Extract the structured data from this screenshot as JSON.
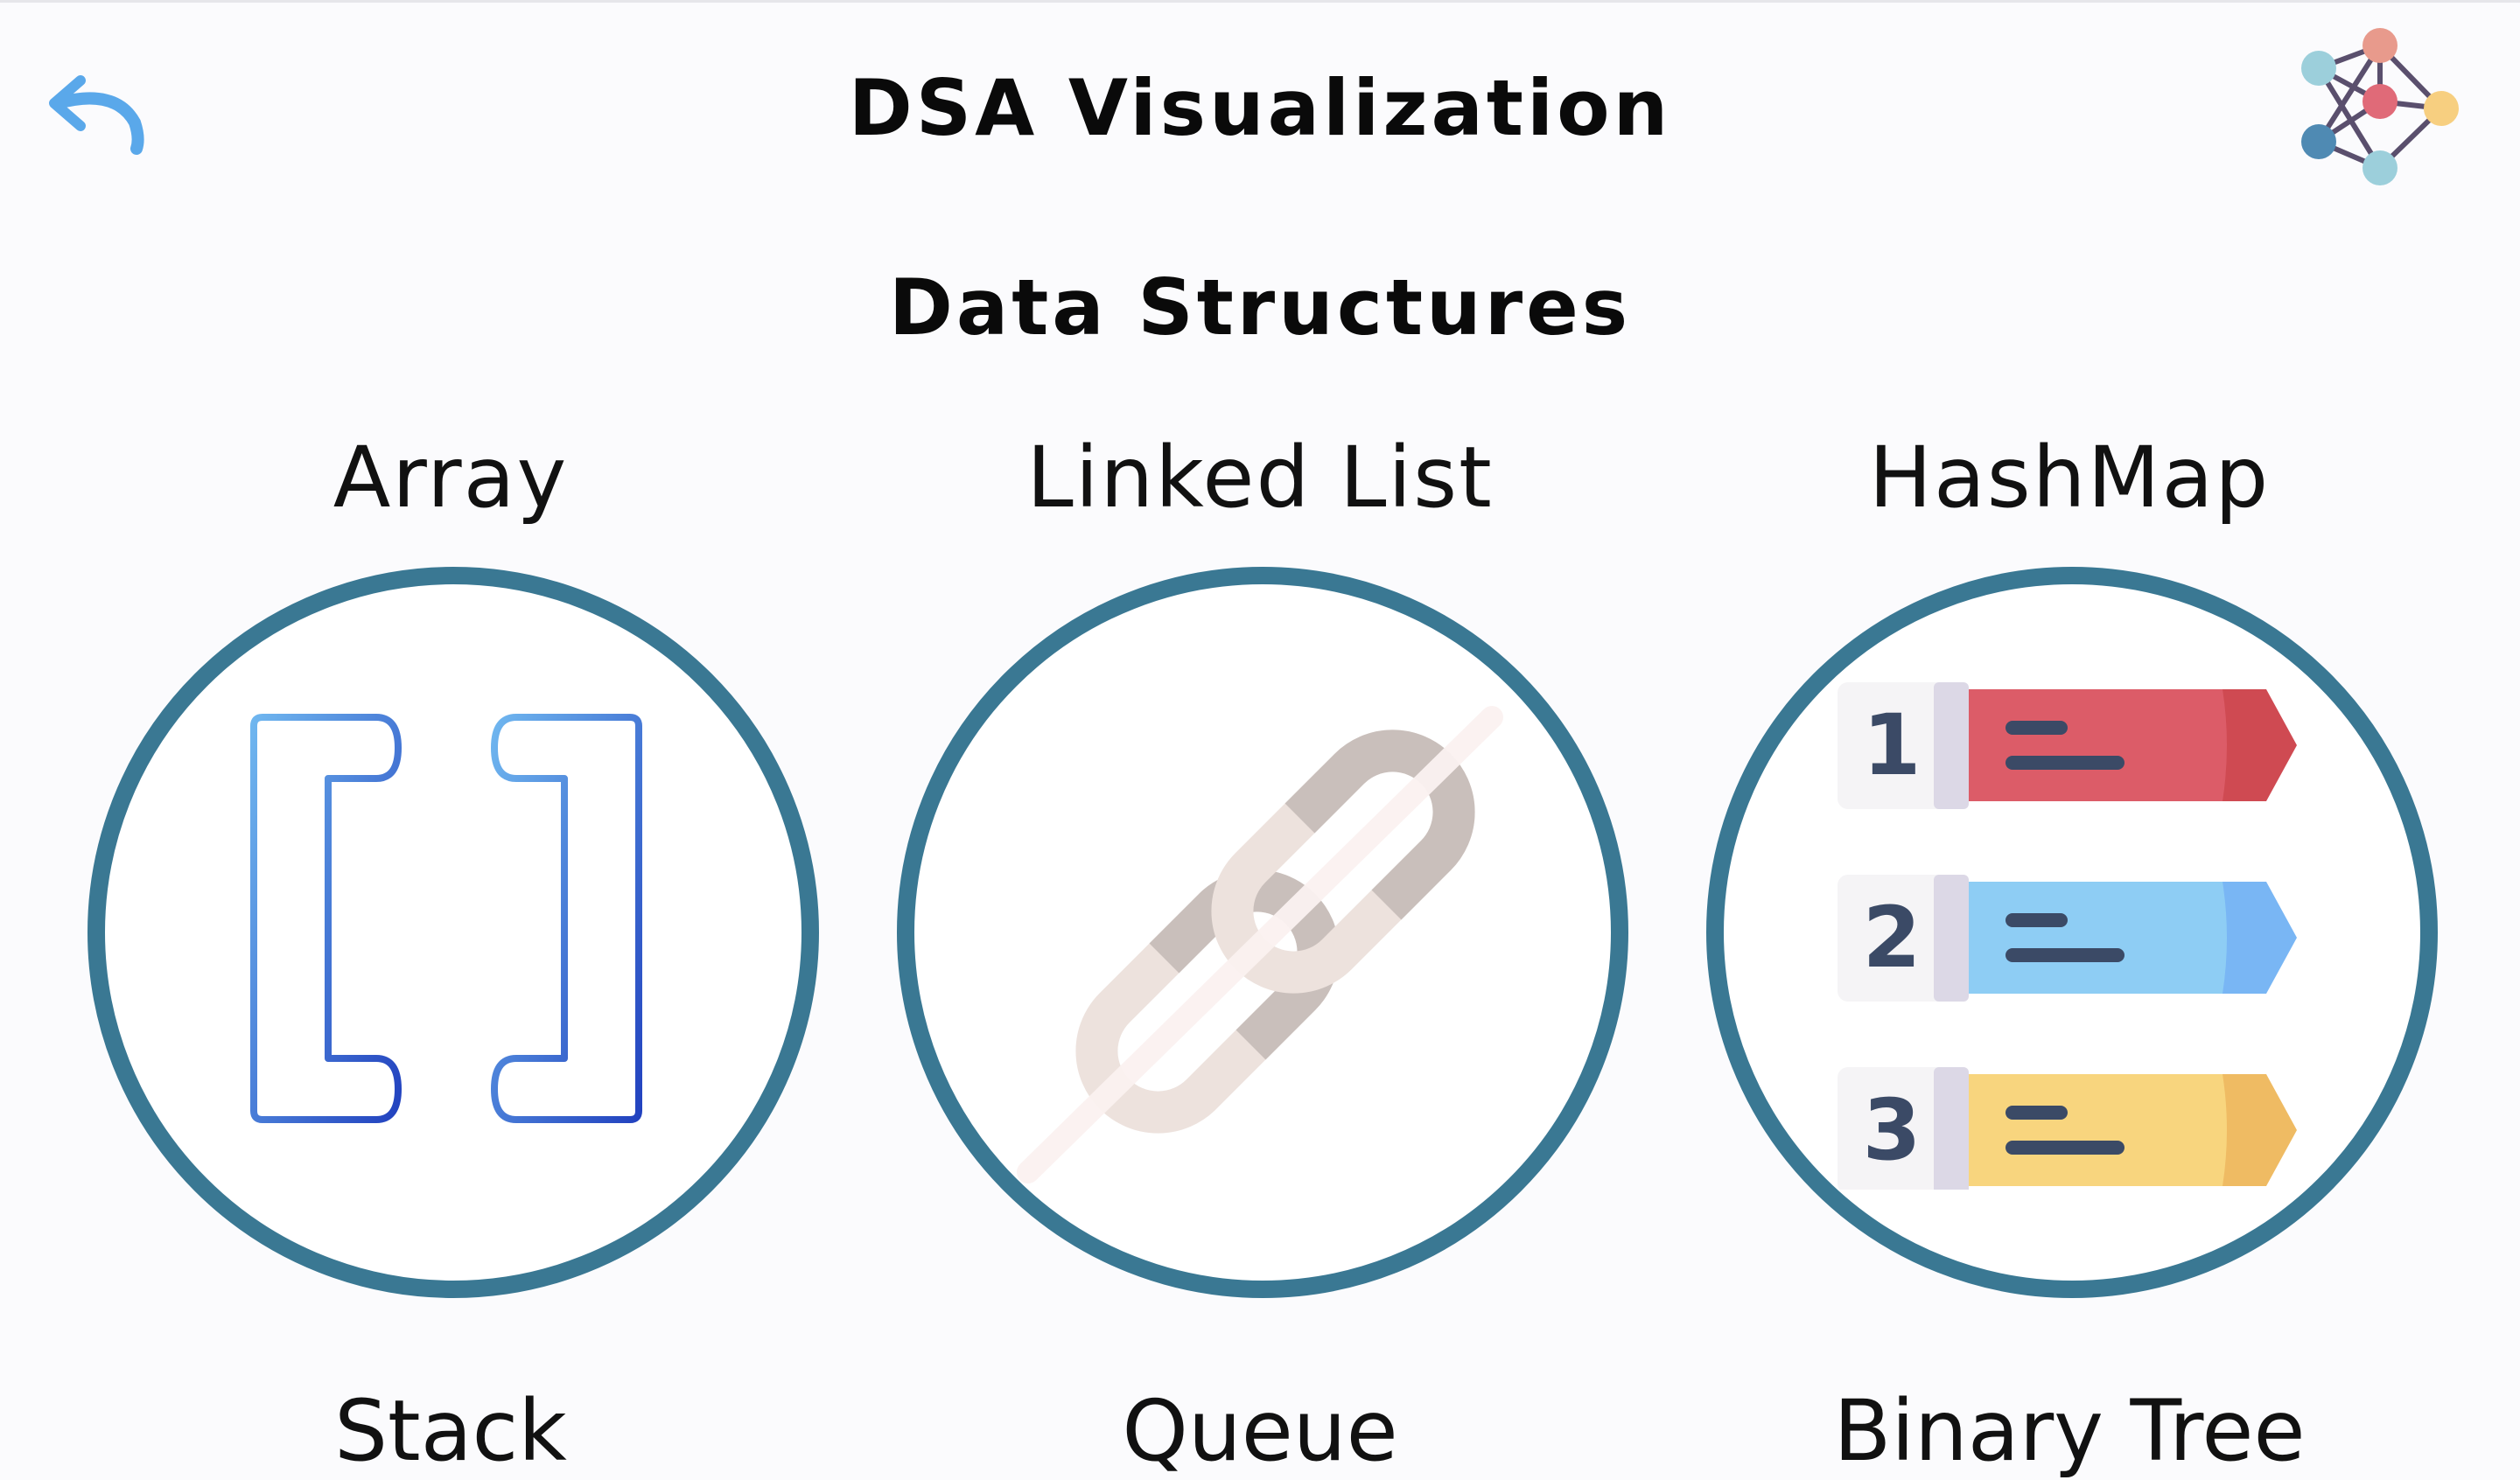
{
  "header": {
    "title": "DSA Visualization",
    "back_icon": "undo-arrow-icon",
    "logo_icon": "network-graph-logo-icon"
  },
  "section": {
    "title": "Data Structures"
  },
  "cards": [
    {
      "label": "Array",
      "icon": "brackets-icon"
    },
    {
      "label": "Linked List",
      "icon": "chain-icon"
    },
    {
      "label": "HashMap",
      "icon": "numbered-list-icon",
      "rows": [
        "1",
        "2",
        "3"
      ]
    }
  ],
  "next_row_labels": [
    "Stack",
    "Queue",
    "Binary Tree"
  ],
  "colors": {
    "ring": "#3a7893",
    "accent_blue": "#5aa8ea",
    "row1": "#dc5c68",
    "row2": "#8ecdf4",
    "row3": "#f8d57e"
  }
}
